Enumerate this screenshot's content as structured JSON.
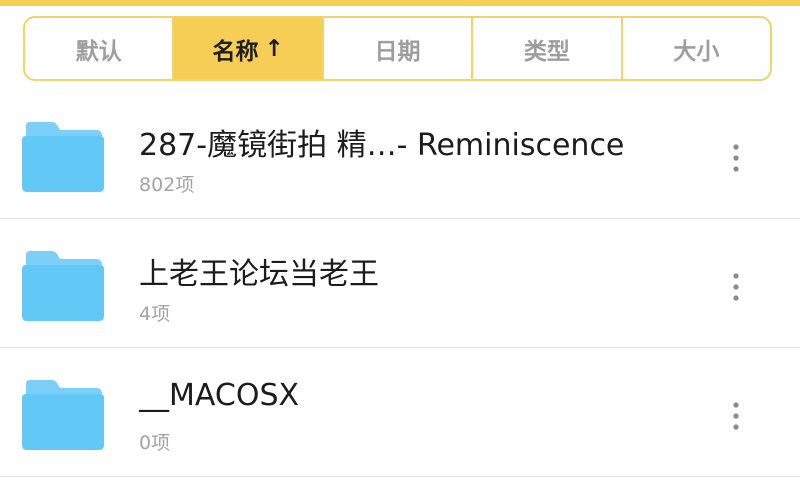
{
  "sort_bar": {
    "tabs": [
      {
        "label": "默认"
      },
      {
        "label": "名称",
        "arrow": "↑"
      },
      {
        "label": "日期"
      },
      {
        "label": "类型"
      },
      {
        "label": "大小"
      }
    ]
  },
  "colors": {
    "accent": "#f6cd55",
    "folder": "#62c8f6",
    "folder_tab": "#8fd9fb"
  },
  "files": [
    {
      "name": "287-魔镜街拍 精…- Reminiscence",
      "count": "802项",
      "icon": "folder-icon"
    },
    {
      "name": "上老王论坛当老王",
      "count": "4项",
      "icon": "folder-icon"
    },
    {
      "name": "__MACOSX",
      "count": "0项",
      "icon": "folder-icon"
    }
  ]
}
